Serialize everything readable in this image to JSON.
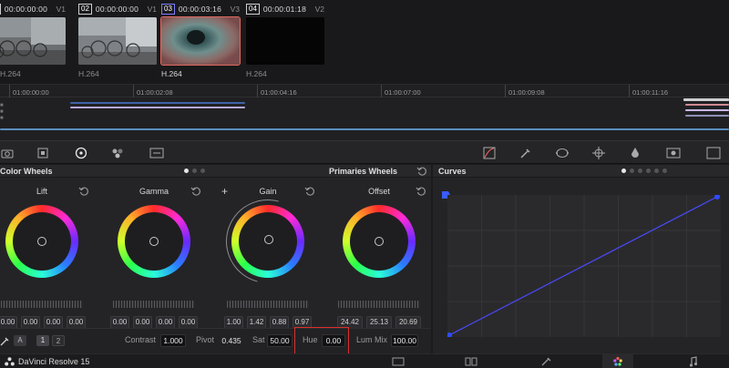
{
  "clips": [
    {
      "num": "01",
      "timecode": "00:00:00:00",
      "track": "V1",
      "codec": "H.264",
      "selected": false,
      "thumb": "bicycles"
    },
    {
      "num": "02",
      "timecode": "00:00:00:00",
      "track": "V1",
      "codec": "H.264",
      "selected": false,
      "thumb": "bicycles-bright"
    },
    {
      "num": "03",
      "timecode": "00:00:03:16",
      "track": "V3",
      "codec": "H.264",
      "selected": true,
      "thumb": "eye"
    },
    {
      "num": "04",
      "timecode": "00:00:01:18",
      "track": "V2",
      "codec": "H.264",
      "selected": false,
      "thumb": "black"
    }
  ],
  "timeline": {
    "ticks": [
      "01:00:00:00",
      "01:00:02:08",
      "01:00:04:16",
      "01:00:07:00",
      "01:00:09:08",
      "01:00:11:16"
    ]
  },
  "color_wheels": {
    "title": "Color Wheels",
    "mode": "Primaries Wheels",
    "wheels": [
      {
        "name": "Lift",
        "values": [
          "0.00",
          "0.00",
          "0.00",
          "0.00"
        ],
        "channels": [
          "Y",
          "R",
          "G",
          "B"
        ]
      },
      {
        "name": "Gamma",
        "values": [
          "0.00",
          "0.00",
          "0.00",
          "0.00"
        ],
        "channels": [
          "Y",
          "R",
          "G",
          "B"
        ]
      },
      {
        "name": "Gain",
        "values": [
          "1.00",
          "1.42",
          "0.88",
          "0.97"
        ],
        "channels": [
          "Y",
          "R",
          "G",
          "B"
        ]
      },
      {
        "name": "Offset",
        "values": [
          "24.42",
          "25.13",
          "20.69"
        ],
        "channels": [
          "R",
          "G",
          "B"
        ]
      }
    ]
  },
  "adjustments": {
    "auto_label": "A",
    "node_1": "1",
    "node_2": "2",
    "contrast_label": "Contrast",
    "contrast": "1.000",
    "pivot_label": "Pivot",
    "pivot": "0.435",
    "sat_label": "Sat",
    "sat": "50.00",
    "hue_label": "Hue",
    "hue": "0.00",
    "lum_mix_label": "Lum Mix",
    "lum_mix": "100.00"
  },
  "curves": {
    "title": "Curves"
  },
  "status": {
    "app_name": "DaVinci Resolve 15",
    "pages": [
      "media-page-icon",
      "edit-page-icon",
      "fusion-page-icon",
      "color-page-icon",
      "fairlight-page-icon"
    ],
    "active_page": "color-page-icon"
  },
  "colors": {
    "highlight": "#d9302c",
    "selected_clip": "#e06a60",
    "curve": "#4a4aff"
  }
}
